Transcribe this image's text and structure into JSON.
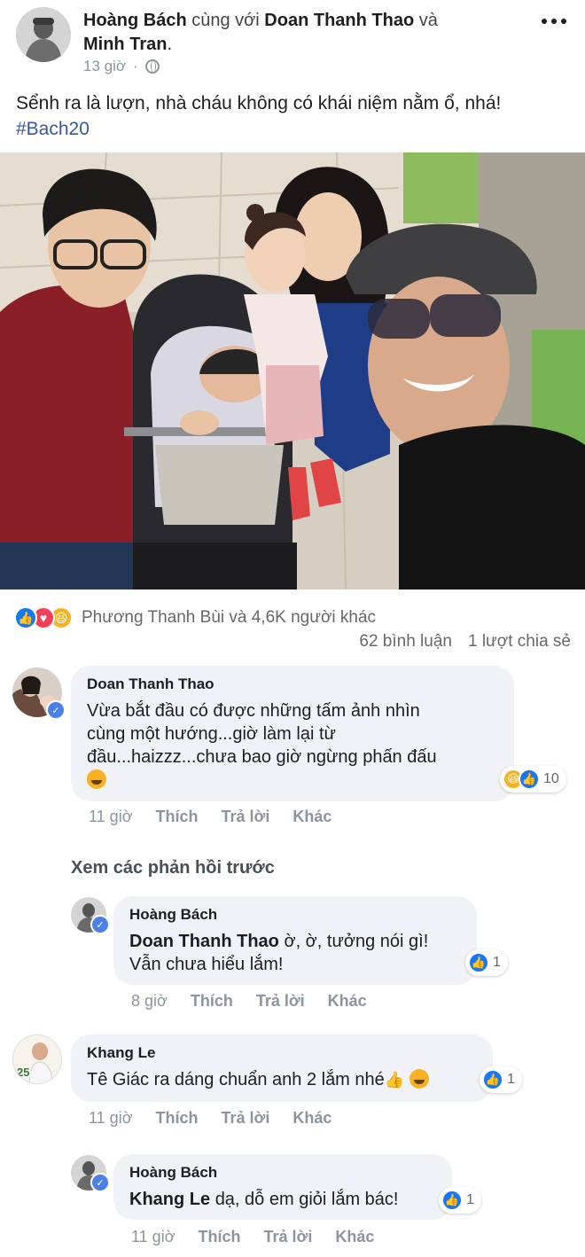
{
  "post": {
    "author": "Hoàng Bách",
    "with_text": "cùng với",
    "tagged1": "Doan Thanh Thao",
    "and_text": "và",
    "tagged2": "Minh Tran",
    "period": ".",
    "time": "13 giờ",
    "text": "Sểnh ra là lượn, nhà cháu không có khái niệm nằm ổ, nhá!",
    "hashtag": "#Bach20"
  },
  "reactions": {
    "icons": [
      "like-icon",
      "love-icon",
      "haha-icon"
    ],
    "summary": "Phương Thanh Bùi và 4,6K người khác",
    "comments_count": "62 bình luận",
    "shares_count": "1 lượt chia sẻ"
  },
  "actions": {
    "like": "Thích",
    "reply": "Trả lời",
    "more": "Khác"
  },
  "view_previous": "Xem các phản hồi trước",
  "comments": [
    {
      "name": "Doan Thanh Thao",
      "line1": "Vừa bắt đầu có được những tấm ảnh nhìn",
      "line2": "cùng một hướng...giờ làm lại từ",
      "line3": "đầu...haizzz...chưa bao giờ ngừng phấn đấu",
      "time": "11 giờ",
      "reaction_count": "10"
    },
    {
      "name": "Hoàng Bách",
      "mention": "Doan Thanh Thao",
      "line1": "ờ, ờ, tưởng nói gì!",
      "line2": "Vẫn chưa hiểu lắm!",
      "time": "8 giờ",
      "reaction_count": "1"
    },
    {
      "name": "Khang Le",
      "text": "Tê Giác ra dáng chuẩn anh 2 lắm nhé",
      "avatar_badge": "25",
      "time": "11 giờ",
      "reaction_count": "1"
    },
    {
      "name": "Hoàng Bách",
      "mention": "Khang Le",
      "text": "dạ, dỗ em giỏi lắm bác!",
      "time": "11 giờ",
      "reaction_count": "1"
    }
  ],
  "colors": {
    "link": "#385898",
    "like_blue": "#1877f2",
    "love_red": "#f33e58",
    "haha_yellow": "#f7b125",
    "bubble_bg": "#f0f2f5",
    "muted": "#8d949e"
  }
}
